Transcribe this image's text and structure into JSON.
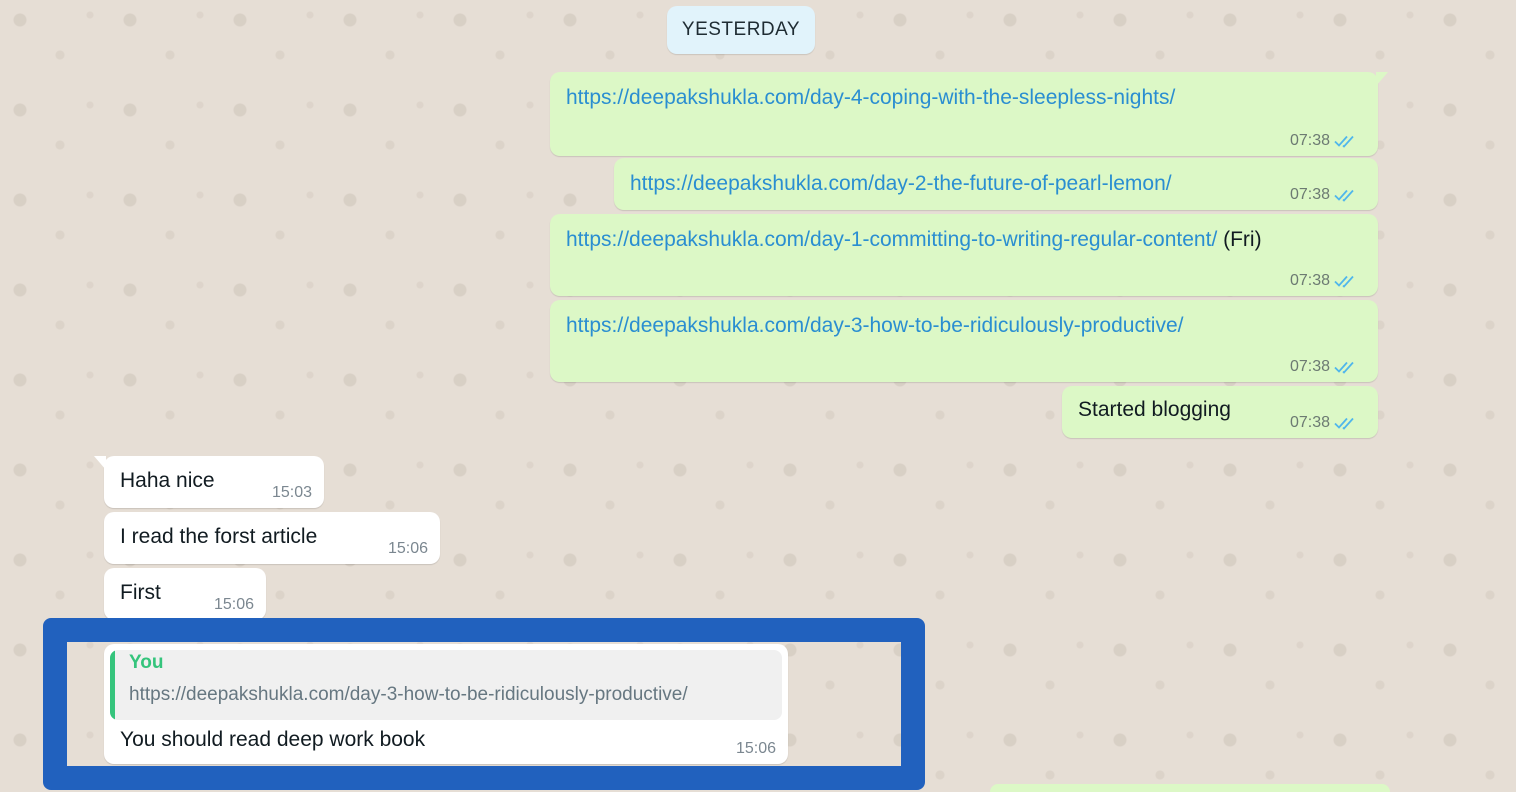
{
  "date_separator": "YESTERDAY",
  "colors": {
    "outgoing_bubble": "#dcf8c6",
    "incoming_bubble": "#ffffff",
    "link": "#2a8ed1",
    "read_ticks": "#4fb6ec",
    "quote_accent": "#35c47c",
    "highlight": "#2161be"
  },
  "outgoing": [
    {
      "link": "https://deepakshukla.com/day-4-coping-with-the-sleepless-nights/",
      "suffix": "",
      "time": "07:38",
      "status": "read"
    },
    {
      "link": "https://deepakshukla.com/day-2-the-future-of-pearl-lemon/",
      "suffix": "",
      "time": "07:38",
      "status": "read"
    },
    {
      "link": "https://deepakshukla.com/day-1-committing-to-writing-regular-content/",
      "suffix": " (Fri)",
      "time": "07:38",
      "status": "read"
    },
    {
      "link": "https://deepakshukla.com/day-3-how-to-be-ridiculously-productive/",
      "suffix": "",
      "time": "07:38",
      "status": "read"
    },
    {
      "text": "Started blogging",
      "time": "07:38",
      "status": "read"
    }
  ],
  "incoming": [
    {
      "text": "Haha nice",
      "time": "15:03"
    },
    {
      "text": "I read the forst article",
      "time": "15:06"
    },
    {
      "text": "First",
      "time": "15:06"
    }
  ],
  "reply": {
    "quoted_author": "You",
    "quoted_text": "https://deepakshukla.com/day-3-how-to-be-ridiculously-productive/",
    "text": "You should read deep work book",
    "time": "15:06"
  }
}
